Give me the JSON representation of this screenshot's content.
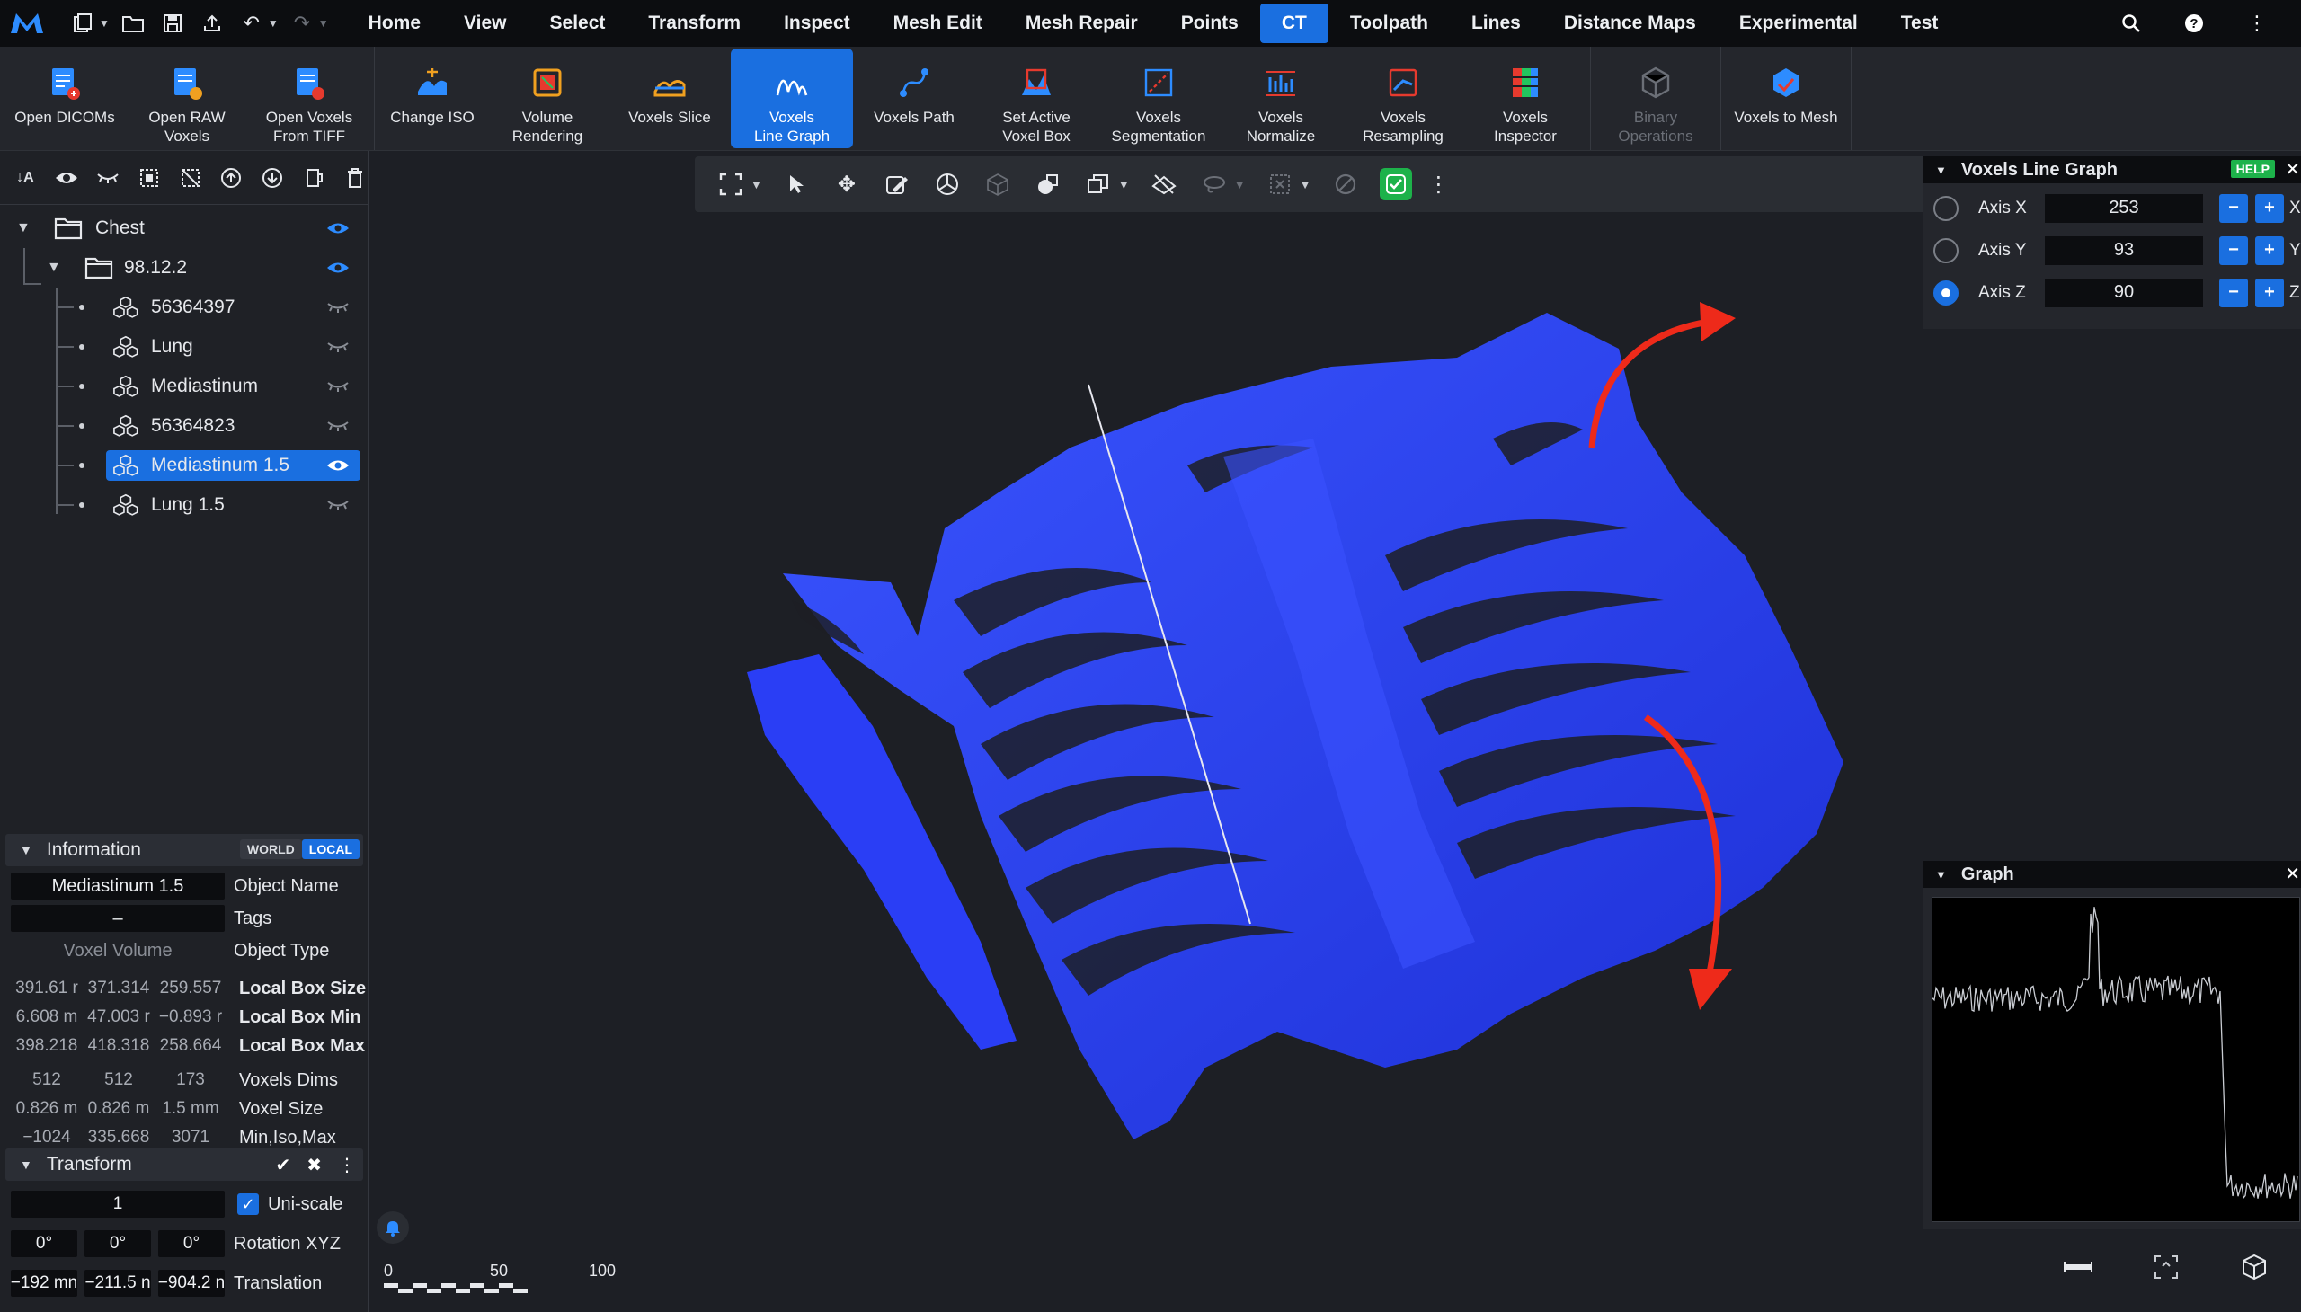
{
  "menubar": {
    "tabs": [
      "Home",
      "View",
      "Select",
      "Transform",
      "Inspect",
      "Mesh Edit",
      "Mesh Repair",
      "Points",
      "CT",
      "Toolpath",
      "Lines",
      "Distance Maps",
      "Experimental",
      "Test"
    ],
    "active_tab": "CT"
  },
  "ribbon": {
    "buttons": [
      {
        "label": "Open DICOMs",
        "icon": "open-dicoms-icon"
      },
      {
        "label": "Open RAW\nVoxels",
        "icon": "open-raw-voxels-icon"
      },
      {
        "label": "Open Voxels\nFrom TIFF",
        "icon": "open-tiff-icon"
      },
      {
        "label": "Change ISO",
        "icon": "change-iso-icon"
      },
      {
        "label": "Volume\nRendering",
        "icon": "volume-rendering-icon"
      },
      {
        "label": "Voxels Slice",
        "icon": "voxels-slice-icon"
      },
      {
        "label": "Voxels\nLine Graph",
        "icon": "line-graph-icon",
        "active": true
      },
      {
        "label": "Voxels Path",
        "icon": "voxels-path-icon"
      },
      {
        "label": "Set Active\nVoxel Box",
        "icon": "voxel-box-icon"
      },
      {
        "label": "Voxels\nSegmentation",
        "icon": "segmentation-icon"
      },
      {
        "label": "Voxels\nNormalize",
        "icon": "normalize-icon"
      },
      {
        "label": "Voxels\nResampling",
        "icon": "resampling-icon"
      },
      {
        "label": "Voxels\nInspector",
        "icon": "inspector-icon"
      },
      {
        "label": "Binary\nOperations",
        "icon": "binary-operations-icon",
        "disabled": true
      },
      {
        "label": "Voxels to Mesh",
        "icon": "voxels-to-mesh-icon"
      }
    ]
  },
  "scene_tree": {
    "root": "Chest",
    "folder": "98.12.2",
    "items": [
      "56364397",
      "Lung",
      "Mediastinum",
      "56364823",
      "Mediastinum 1.5",
      "Lung 1.5"
    ],
    "selected": "Mediastinum 1.5"
  },
  "info": {
    "title": "Information",
    "world": "WORLD",
    "local": "LOCAL",
    "object_name": "Mediastinum 1.5",
    "object_name_key": "Object Name",
    "tags": "–",
    "tags_key": "Tags",
    "object_type": "Voxel Volume",
    "object_type_key": "Object Type",
    "local_box_size": [
      "391.61 r",
      "371.314",
      "259.557"
    ],
    "local_box_size_key": "Local Box Size",
    "local_box_min": [
      "6.608 m",
      "47.003 r",
      "−0.893 r"
    ],
    "local_box_min_key": "Local Box Min",
    "local_box_max": [
      "398.218",
      "418.318",
      "258.664"
    ],
    "local_box_max_key": "Local Box Max",
    "voxels_dims": [
      "512",
      "512",
      "173"
    ],
    "voxels_dims_key": "Voxels Dims",
    "voxel_size": [
      "0.826 m",
      "0.826 m",
      "1.5 mm"
    ],
    "voxel_size_key": "Voxel Size",
    "min_iso_max": [
      "−1024",
      "335.668",
      "3071"
    ],
    "min_iso_max_key": "Min,Iso,Max"
  },
  "transform": {
    "title": "Transform",
    "scale": "1",
    "uniscale_label": "Uni-scale",
    "rotation": [
      "0°",
      "0°",
      "0°"
    ],
    "rotation_key": "Rotation XYZ",
    "translation": [
      "−192 mn",
      "−211.5 n",
      "−904.2 n"
    ],
    "translation_key": "Translation"
  },
  "voxels_line_graph": {
    "title": "Voxels Line Graph",
    "help": "HELP",
    "axes": [
      {
        "label": "Axis X",
        "value": "253",
        "letter": "X",
        "selected": false
      },
      {
        "label": "Axis Y",
        "value": "93",
        "letter": "Y",
        "selected": false
      },
      {
        "label": "Axis Z",
        "value": "90",
        "letter": "Z",
        "selected": true
      }
    ]
  },
  "graph_panel": {
    "title": "Graph"
  },
  "scale_bar": {
    "ticks": [
      "0",
      "50",
      "100"
    ]
  },
  "colors": {
    "accent": "#1a6fe0",
    "model": "#2a3ef5",
    "arrow": "#ee2a1a",
    "green": "#1db24a"
  }
}
